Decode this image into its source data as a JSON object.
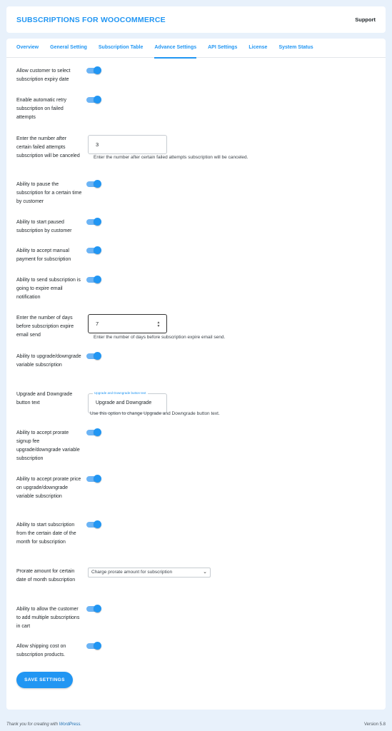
{
  "header": {
    "brand": "SUBSCRIPTIONS FOR WOOCOMMERCE",
    "support": "Support"
  },
  "tabs": [
    {
      "label": "Overview"
    },
    {
      "label": "General Setting"
    },
    {
      "label": "Subscription Table"
    },
    {
      "label": "Advance Settings",
      "active": true
    },
    {
      "label": "API Settings"
    },
    {
      "label": "License"
    },
    {
      "label": "System Status"
    }
  ],
  "settings": {
    "expiry_date": {
      "label": "Allow customer to select subscription expiry date",
      "enabled": true
    },
    "auto_retry": {
      "label": "Enable automatic retry subscription on failed attempts",
      "enabled": true
    },
    "failed_attempts": {
      "label": "Enter the number after certain failed attempts subscription will be canceled",
      "value": "3",
      "help": "Enter the number after certain failed attempts subscription will be canceled."
    },
    "pause": {
      "label": "Ability to pause the subscription for a certain time by customer",
      "enabled": true
    },
    "start_paused": {
      "label": "Ability to start paused subscription by customer",
      "enabled": true
    },
    "manual_payment": {
      "label": "Ability to accept manual payment for subscription",
      "enabled": true
    },
    "expire_email": {
      "label": "Ability to send subscription is going to expire email notification",
      "enabled": true
    },
    "expire_days": {
      "label": "Enter the number of days before subscription expire email send",
      "value": "7",
      "help": "Enter the number of days before subscription expire email send."
    },
    "upgrade_downgrade": {
      "label": "Ability to upgrade/downgrade variable subscription",
      "enabled": true
    },
    "upgrade_text": {
      "label": "Upgrade and Downgrade button text",
      "legend": "Upgrade and Downgrade button text",
      "value": "Upgrade and Downgrade",
      "help": "Use this option to change Upgrade and Downgrade button text."
    },
    "prorate_signup": {
      "label": "Ability to accept prorate signup fee upgrade/downgrade variable subscription",
      "enabled": true
    },
    "prorate_price": {
      "label": "Ability to accept prorate price on upgrade/downgrade variable subscription",
      "enabled": true
    },
    "start_date": {
      "label": "Ability to start subscription from the certain date of the month for subscription",
      "enabled": true
    },
    "prorate_amount": {
      "label": "Prorate amount for certain date of month subscription",
      "selected": "Charge prorate amount for subscription"
    },
    "multiple_cart": {
      "label": "Ability to allow the customer to add multiple subscriptions in cart",
      "enabled": true
    },
    "shipping_cost": {
      "label": "Allow shipping cost on subscription products.",
      "enabled": true
    }
  },
  "save_label": "SAVE SETTINGS",
  "footer": {
    "prefix": "Thank you for creating with ",
    "link": "WordPress",
    "suffix": ".",
    "version": "Version 5.8"
  },
  "colors": {
    "accent": "#2196f3",
    "background": "#e8f1fb"
  }
}
